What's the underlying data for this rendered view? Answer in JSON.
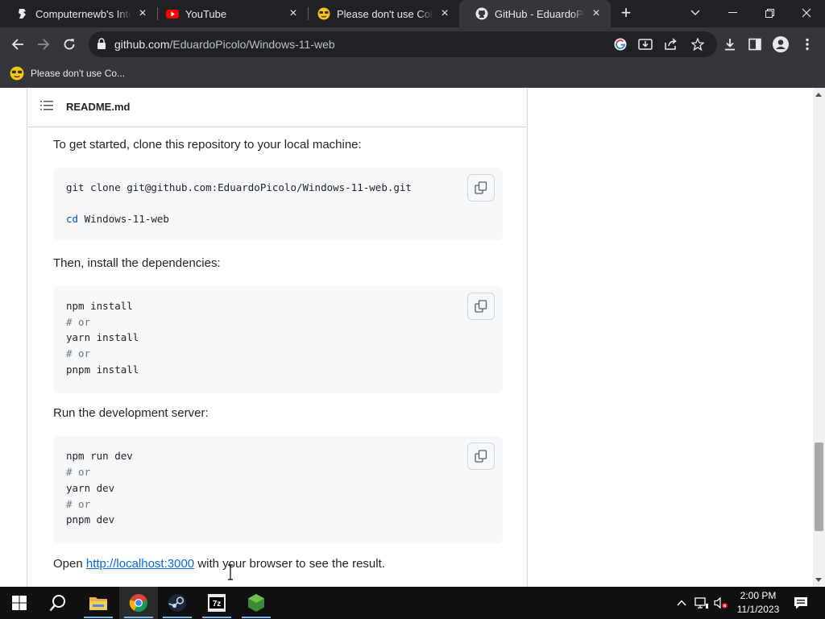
{
  "tabs": [
    {
      "title": "Computernewb's Inter",
      "icon": "computernewb-icon"
    },
    {
      "title": "YouTube",
      "icon": "youtube-icon"
    },
    {
      "title": "Please don't use Colla",
      "icon": "emoji-icon"
    },
    {
      "title": "GitHub - EduardoPicol",
      "icon": "github-icon",
      "active": true
    }
  ],
  "address": {
    "host": "github.com",
    "path": "/EduardoPicolo/Windows-11-web"
  },
  "bookmarks": [
    {
      "label": "Please don't use Co...",
      "icon": "emoji-icon"
    }
  ],
  "readme": {
    "filename": "README.md",
    "intro": "To get started, clone this repository to your local machine:",
    "clone_block": {
      "lines": [
        "git clone git@github.com:EduardoPicolo/Windows-11-web.git",
        "",
        "Windows-11-web"
      ],
      "cd_keyword": "cd"
    },
    "install_text": "Then, install the dependencies:",
    "install_block": {
      "lines": [
        "npm install",
        "# or",
        "yarn install",
        "# or",
        "pnpm install"
      ]
    },
    "run_text": "Run the development server:",
    "run_block": {
      "lines": [
        "npm run dev",
        "# or",
        "yarn dev",
        "# or",
        "pnpm dev"
      ]
    },
    "open_text": {
      "prefix": "Open",
      "link": "http://localhost:3000",
      "suffix": "with your browser to see the result."
    }
  },
  "taskbar": {
    "apps": [
      "start-icon",
      "search-icon",
      "file-explorer-icon",
      "chrome-icon",
      "steam-icon",
      "7zip-icon",
      "nodejs-icon"
    ],
    "sevenzip_label": "7z"
  },
  "clock": {
    "time": "2:00 PM",
    "date": "11/1/2023"
  },
  "colors": {
    "link": "#0969da",
    "code_bg": "#f6f8fa",
    "tab_bg": "#202124",
    "toolbar_bg": "#35363a"
  }
}
